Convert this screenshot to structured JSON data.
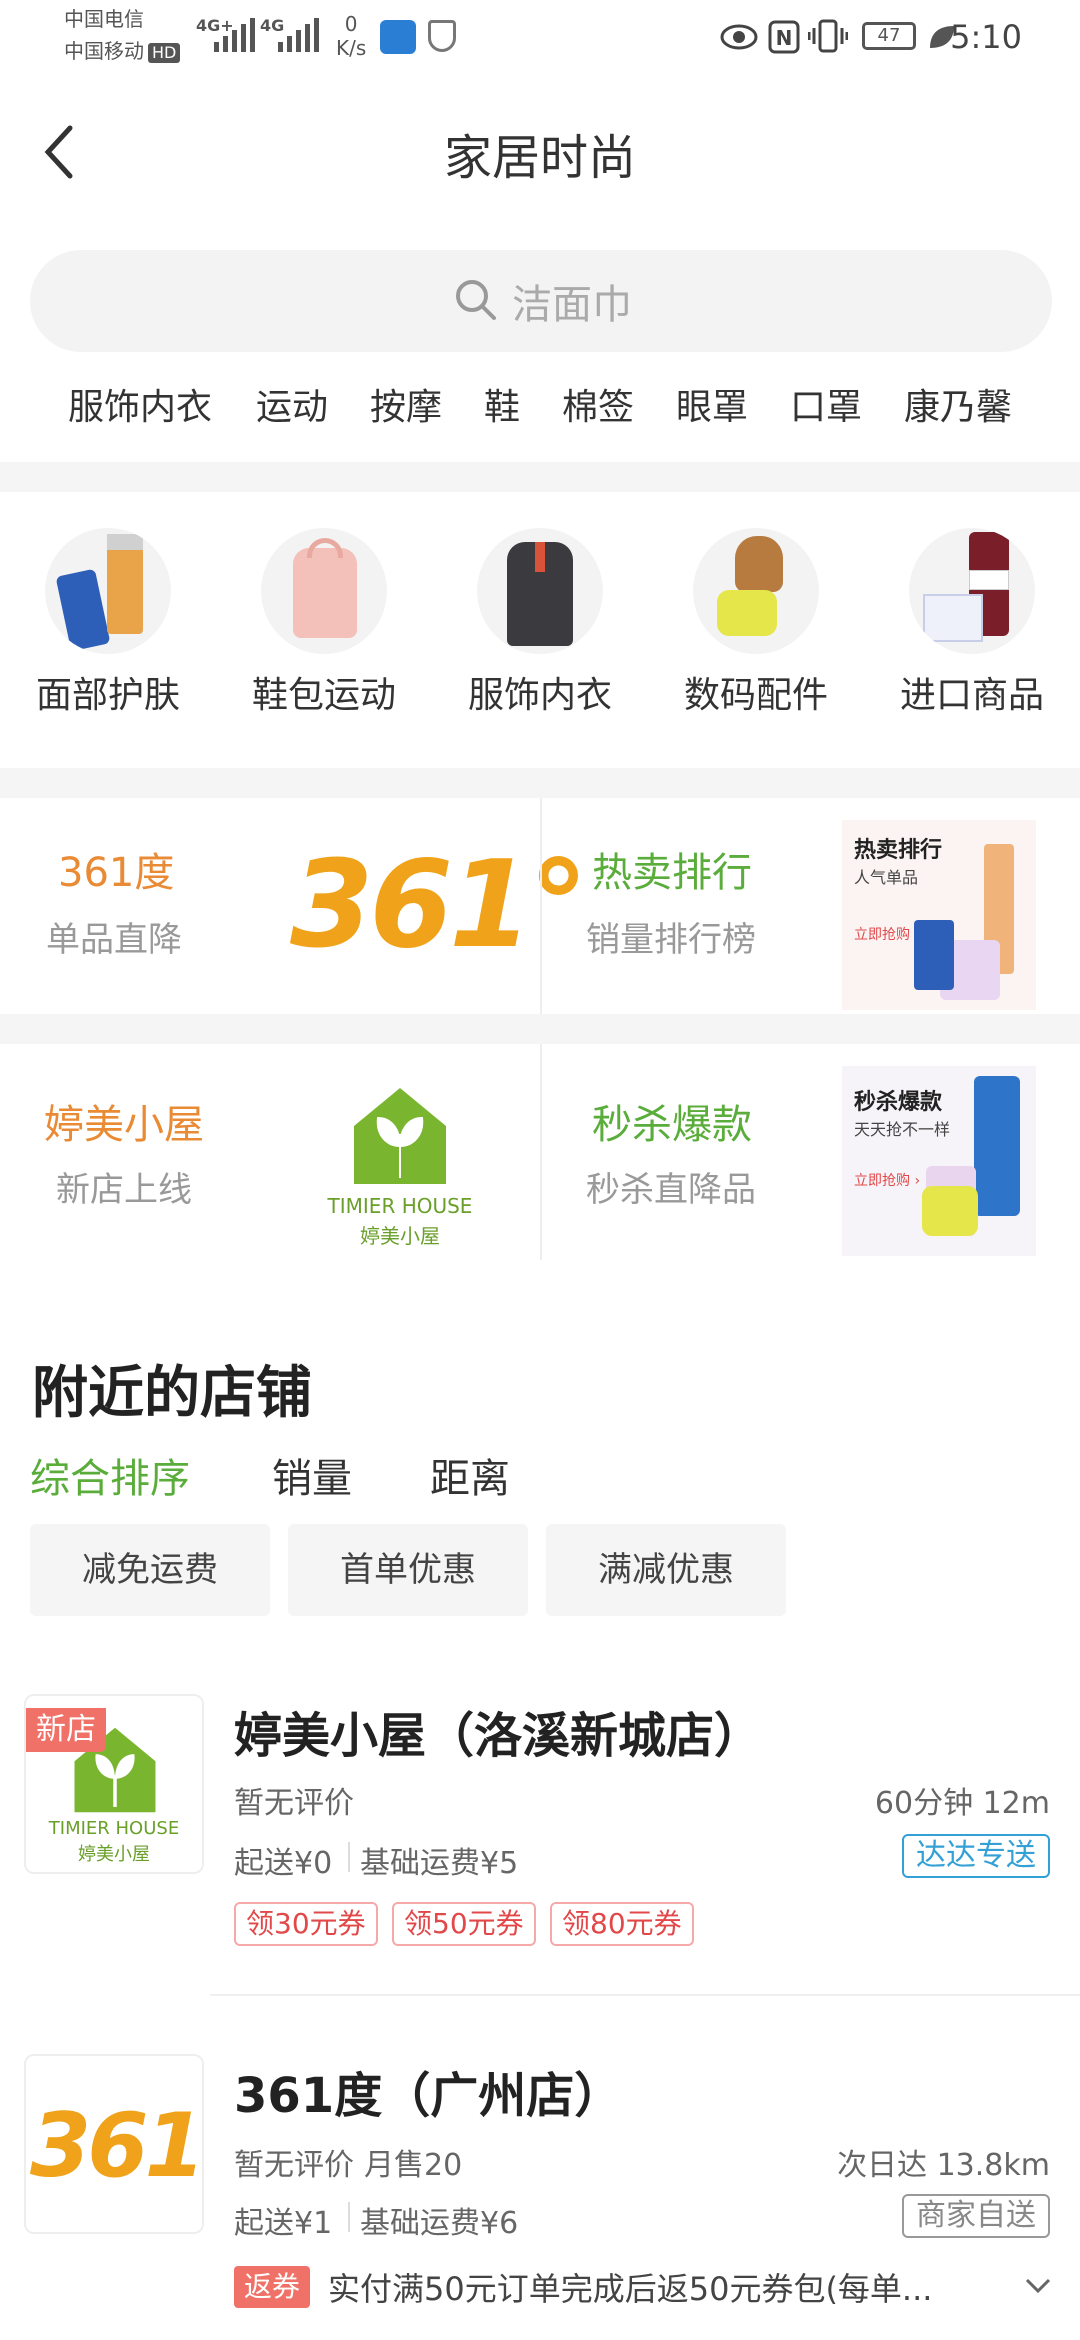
{
  "status_bar": {
    "carrier1": "中国电信",
    "carrier2": "中国移动",
    "hd": "HD",
    "net1": "4G+",
    "net2": "4G",
    "speed_value": "0",
    "speed_unit": "K/s",
    "battery": "47",
    "time": "5:10"
  },
  "header": {
    "title": "家居时尚",
    "back_icon": "chevron-left-icon"
  },
  "search": {
    "placeholder": "洁面巾"
  },
  "categories": [
    "服饰内衣",
    "运动",
    "按摩",
    "鞋",
    "棉签",
    "眼罩",
    "口罩",
    "康乃馨"
  ],
  "icon_nav": [
    {
      "label": "面部护肤",
      "icon": "skincare-icon"
    },
    {
      "label": "鞋包运动",
      "icon": "backpack-icon"
    },
    {
      "label": "服饰内衣",
      "icon": "jacket-icon"
    },
    {
      "label": "数码配件",
      "icon": "speaker-icon"
    },
    {
      "label": "进口商品",
      "icon": "import-goods-icon"
    }
  ],
  "promos": [
    {
      "title": "361度",
      "subtitle": "单品直降",
      "logo_text": "361°"
    },
    {
      "title": "热卖排行",
      "subtitle": "销量排行榜",
      "img_title": "热卖排行",
      "img_sub": "人气单品",
      "img_cta": "立即抢购 ›"
    },
    {
      "title": "婷美小屋",
      "subtitle": "新店上线",
      "logo_en": "TIMIER HOUSE",
      "logo_cn": "婷美小屋"
    },
    {
      "title": "秒杀爆款",
      "subtitle": "秒杀直降品",
      "img_title": "秒杀爆款",
      "img_sub": "天天抢不一样",
      "img_cta": "立即抢购 ›"
    }
  ],
  "nearby": {
    "title": "附近的店铺",
    "sorts": [
      "综合排序",
      "销量",
      "距离"
    ],
    "filters": [
      "减免运费",
      "首单优惠",
      "满减优惠"
    ]
  },
  "shops": [
    {
      "badge": "新店",
      "logo_en": "TIMIER HOUSE",
      "logo_cn": "婷美小屋",
      "name": "婷美小屋（洛溪新城店）",
      "rating": "暂无评价",
      "time_distance": "60分钟  12m",
      "min_order": "起送¥0",
      "delivery_fee": "基础运费¥5",
      "delivery_tag": "达达专送",
      "coupons": [
        "领30元券",
        "领50元券",
        "领80元券"
      ]
    },
    {
      "logo_text": "361°",
      "name": "361度（广州店）",
      "rating": "暂无评价",
      "monthly_sales": "月售20",
      "time_distance": "次日达  13.8km",
      "min_order": "起送¥1",
      "delivery_fee": "基础运费¥6",
      "delivery_tag": "商家自送",
      "promo_badge": "返券",
      "promo_text": "实付满50元订单完成后返50元券包(每单..."
    }
  ],
  "colors": {
    "orange": "#e98a35",
    "green": "#5aad3a",
    "gray_text": "#999999",
    "blue_tag": "#33a0d6",
    "red": "#e2484a"
  }
}
